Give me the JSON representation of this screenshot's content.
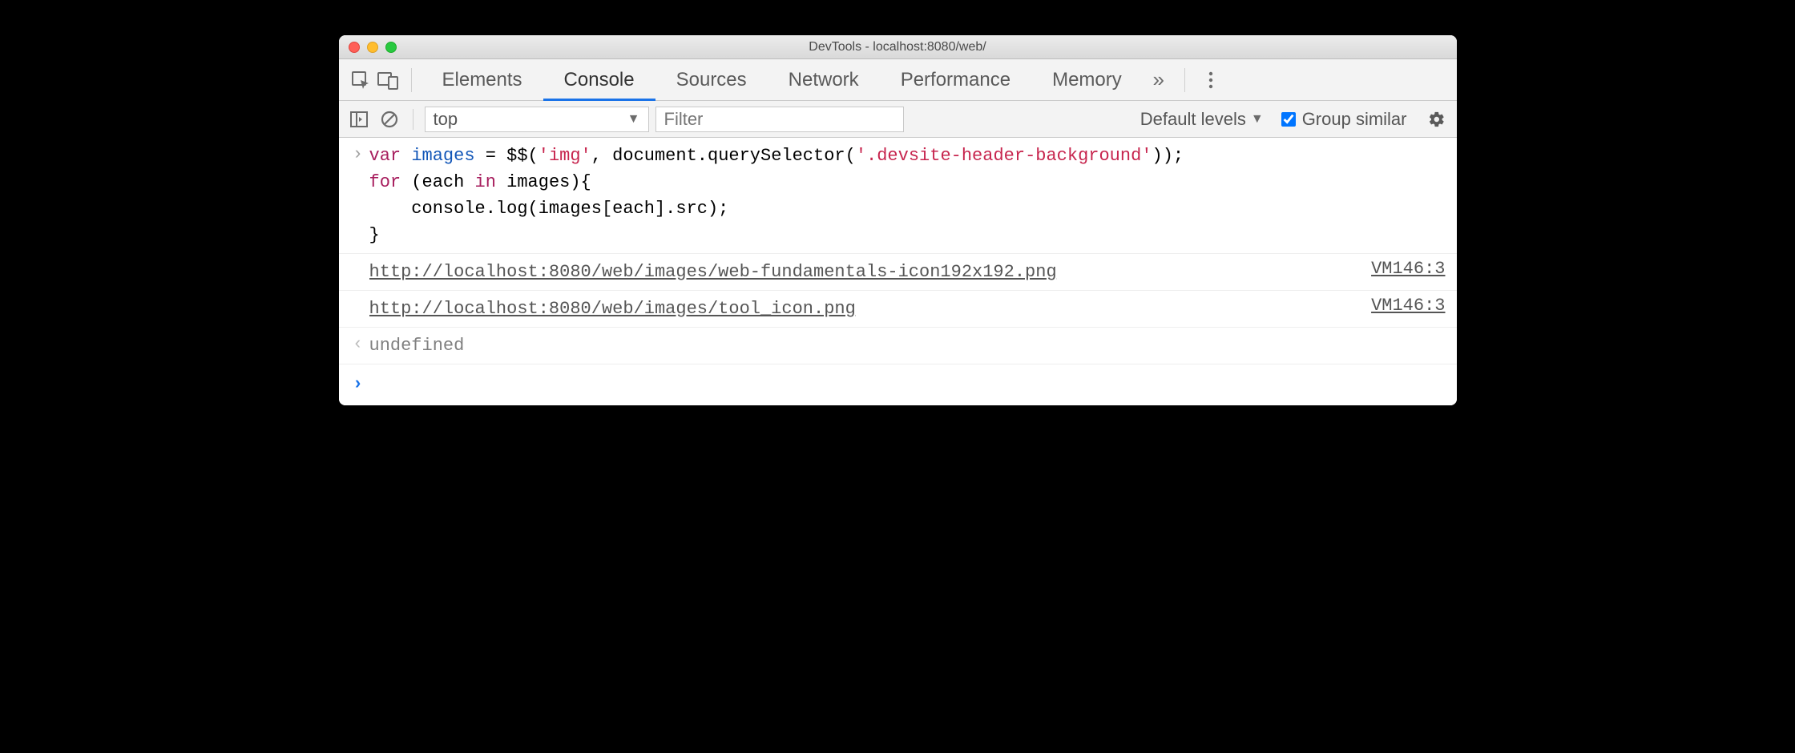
{
  "window": {
    "title": "DevTools - localhost:8080/web/"
  },
  "tabs": {
    "items": [
      "Elements",
      "Console",
      "Sources",
      "Network",
      "Performance",
      "Memory"
    ],
    "active_index": 1,
    "overflow_glyph": "»"
  },
  "toolbar": {
    "context": "top",
    "filter_placeholder": "Filter",
    "levels_label": "Default levels",
    "group_similar_label": "Group similar",
    "group_similar_checked": true
  },
  "console": {
    "input_tokens": [
      {
        "t": "kw",
        "v": "var"
      },
      {
        "t": "",
        "v": " "
      },
      {
        "t": "ident",
        "v": "images"
      },
      {
        "t": "",
        "v": " = $$("
      },
      {
        "t": "str",
        "v": "'img'"
      },
      {
        "t": "",
        "v": ", document.querySelector("
      },
      {
        "t": "str",
        "v": "'.devsite-header-background'"
      },
      {
        "t": "",
        "v": "));\n"
      },
      {
        "t": "kw",
        "v": "for"
      },
      {
        "t": "",
        "v": " (each "
      },
      {
        "t": "kw",
        "v": "in"
      },
      {
        "t": "",
        "v": " images){\n    console.log(images[each].src);\n}"
      }
    ],
    "logs": [
      {
        "text": "http://localhost:8080/web/images/web-fundamentals-icon192x192.png",
        "source": "VM146:3"
      },
      {
        "text": "http://localhost:8080/web/images/tool_icon.png",
        "source": "VM146:3"
      }
    ],
    "return_value": "undefined"
  }
}
